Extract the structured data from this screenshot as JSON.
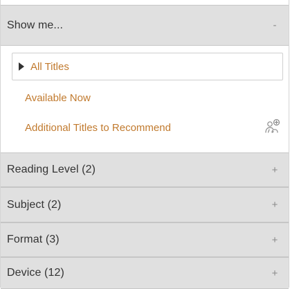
{
  "show_me": {
    "title": "Show me...",
    "toggle": "-",
    "options": [
      {
        "label": "All Titles",
        "selected": true
      },
      {
        "label": "Available Now"
      },
      {
        "label": "Additional Titles to Recommend"
      }
    ],
    "recommend_icon": "recommend-icon"
  },
  "facets": [
    {
      "title": "Reading Level (2)",
      "toggle": "+"
    },
    {
      "title": "Subject (2)",
      "toggle": "+"
    },
    {
      "title": "Format (3)",
      "toggle": "+"
    },
    {
      "title": "Device (12)",
      "toggle": "+"
    }
  ],
  "colors": {
    "link": "#c17a2e",
    "header_bg": "#e0e0e0",
    "header_text": "#333333",
    "toggle": "#8a8a8a"
  }
}
